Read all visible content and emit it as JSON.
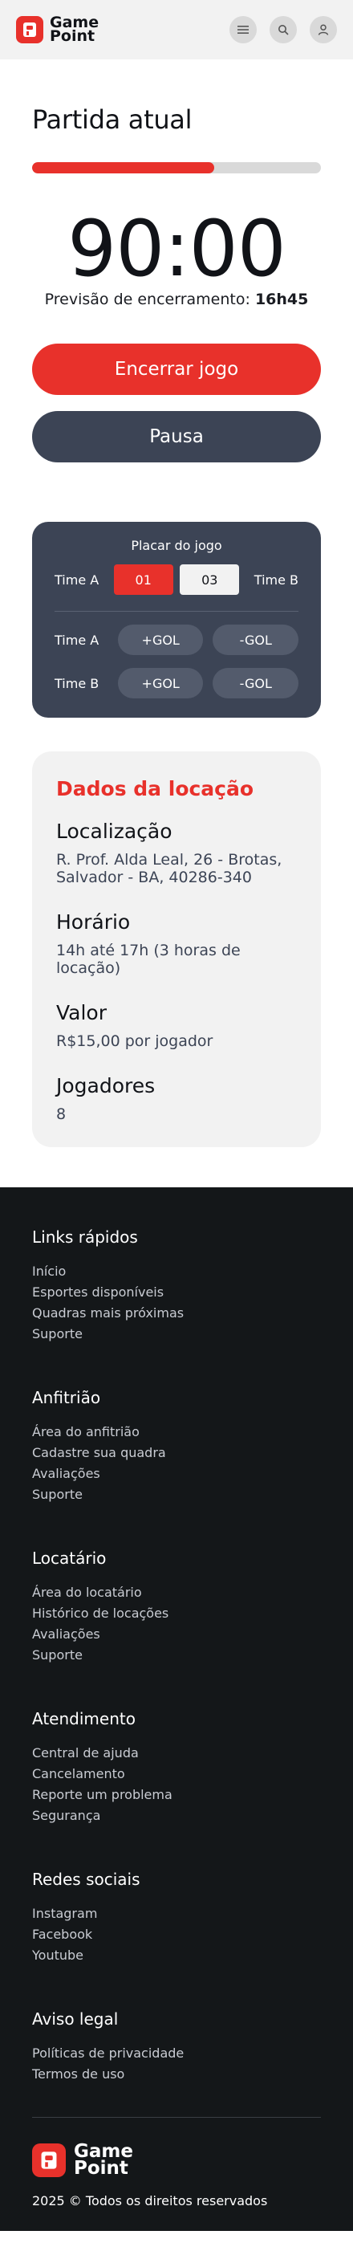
{
  "header": {
    "logo_line1": "Game",
    "logo_line2": "Point",
    "icons": [
      "menu-icon",
      "search-icon",
      "user-icon"
    ]
  },
  "match": {
    "title": "Partida atual",
    "progress_fraction": 0.63,
    "timer": "90:00",
    "forecast_label": "Previsão de  encerramento:",
    "forecast_time": "16h45",
    "end_button": "Encerrar jogo",
    "pause_button": "Pausa"
  },
  "scoreboard": {
    "title": "Placar do jogo",
    "team_a": "Time A",
    "team_b": "Time B",
    "score_a": "01",
    "score_b": "03",
    "goal_plus": "+GOL",
    "goal_minus": "-GOL"
  },
  "rental": {
    "title": "Dados da locação",
    "location_label": "Localização",
    "location_value": "R. Prof. Alda Leal, 26 - Brotas, Salvador - BA, 40286-340",
    "schedule_label": "Horário",
    "schedule_value": "14h até 17h (3 horas de locação)",
    "price_label": "Valor",
    "price_value": "R$15,00 por jogador",
    "players_label": "Jogadores",
    "players_value": "8"
  },
  "footer": {
    "sections": [
      {
        "title": "Links rápidos",
        "links": [
          "Início",
          "Esportes disponíveis",
          "Quadras mais próximas",
          "Suporte"
        ]
      },
      {
        "title": "Anfitrião",
        "links": [
          "Área do anfitrião",
          "Cadastre sua quadra",
          "Avaliações",
          "Suporte"
        ]
      },
      {
        "title": "Locatário",
        "links": [
          "Área do locatário",
          "Histórico de locações",
          "Avaliações",
          "Suporte"
        ]
      },
      {
        "title": "Atendimento",
        "links": [
          "Central de ajuda",
          "Cancelamento",
          "Reporte um problema",
          "Segurança"
        ]
      },
      {
        "title": "Redes sociais",
        "links": [
          "Instagram",
          "Facebook",
          "Youtube"
        ]
      },
      {
        "title": "Aviso legal",
        "links": [
          "Políticas de privacidade",
          "Termos de uso"
        ]
      }
    ],
    "logo_line1": "Game",
    "logo_line2": "Point",
    "copyright": "2025 © Todos os direitos reservados"
  },
  "colors": {
    "accent": "#e8312b",
    "slate": "#3c4455",
    "footer_bg": "#141719",
    "panel_bg": "#f2f2f2"
  }
}
